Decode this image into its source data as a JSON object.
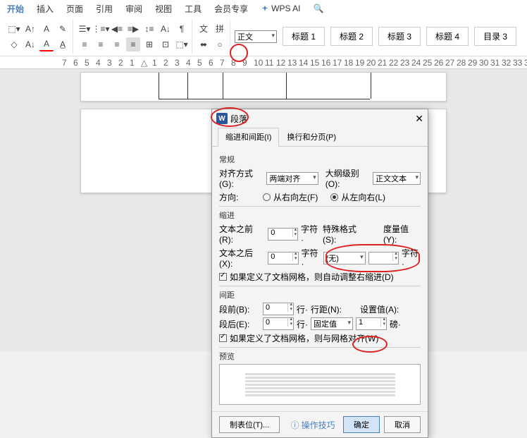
{
  "menu": {
    "items": [
      "开始",
      "插入",
      "页面",
      "引用",
      "审阅",
      "视图",
      "工具",
      "会员专享"
    ],
    "active": 0,
    "ai": "WPS AI"
  },
  "styles": {
    "items": [
      "正文",
      "标题 1",
      "标题 2",
      "标题 3",
      "标题 4",
      "目录 3"
    ],
    "selected": 0
  },
  "dialog": {
    "title": "段落",
    "tabs": {
      "tab1": "缩进和间距(I)",
      "tab2": "换行和分页(P)"
    },
    "general": {
      "label": "常规",
      "align_label": "对齐方式(G):",
      "align_value": "两端对齐",
      "outline_label": "大纲级别(O):",
      "outline_value": "正文文本",
      "dir_label": "方向:",
      "rtl": "从右向左(F)",
      "ltr": "从左向右(L)"
    },
    "indent": {
      "label": "缩进",
      "before_label": "文本之前(R):",
      "before_val": "0",
      "after_label": "文本之后(X):",
      "after_val": "0",
      "unit": "字符·",
      "special_label": "特殊格式(S):",
      "special_val": "(无)",
      "measure_label": "度量值(Y):",
      "auto_adjust": "如果定义了文档网格，则自动调整右缩进(D)"
    },
    "spacing": {
      "label": "间距",
      "before_label": "段前(B):",
      "before_val": "0",
      "after_label": "段后(E):",
      "after_val": "0",
      "unit_line": "行·",
      "line_spacing_label": "行距(N):",
      "line_spacing_val": "固定值",
      "set_value_label": "设置值(A):",
      "set_value": "1",
      "unit_pt": "磅·",
      "grid_align": "如果定义了文档网格，则与网格对齐(W)"
    },
    "preview_label": "预览",
    "footer": {
      "tabstops": "制表位(T)...",
      "tips": "操作技巧",
      "ok": "确定",
      "cancel": "取消"
    }
  }
}
